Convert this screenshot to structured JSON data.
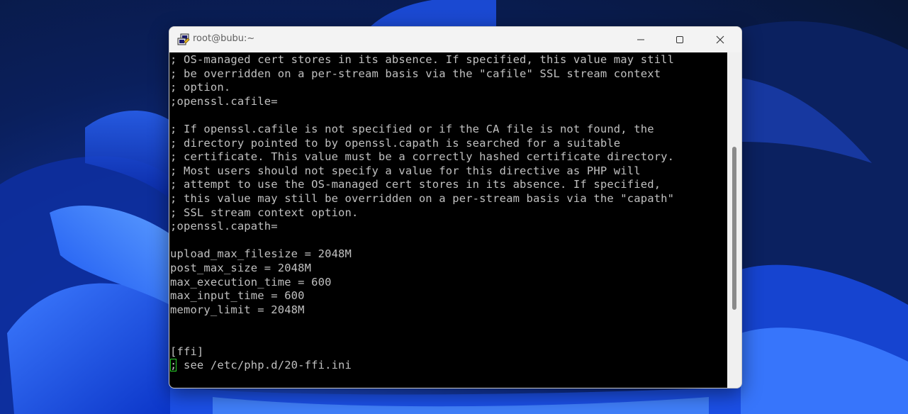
{
  "window": {
    "title": "root@bubu:~",
    "icon": "putty-icon",
    "controls": {
      "minimize": "minimize-icon",
      "maximize": "maximize-icon",
      "close": "close-icon"
    }
  },
  "terminal": {
    "lines": [
      "; OS-managed cert stores in its absence. If specified, this value may still",
      "; be overridden on a per-stream basis via the \"cafile\" SSL stream context",
      "; option.",
      ";openssl.cafile=",
      "",
      "; If openssl.cafile is not specified or if the CA file is not found, the",
      "; directory pointed to by openssl.capath is searched for a suitable",
      "; certificate. This value must be a correctly hashed certificate directory.",
      "; Most users should not specify a value for this directive as PHP will",
      "; attempt to use the OS-managed cert stores in its absence. If specified,",
      "; this value may still be overridden on a per-stream basis via the \"capath\"",
      "; SSL stream context option.",
      ";openssl.capath=",
      "",
      "upload_max_filesize = 2048M",
      "post_max_size = 2048M",
      "max_execution_time = 600",
      "max_input_time = 600",
      "memory_limit = 2048M",
      "",
      "",
      "[ffi]"
    ],
    "cursor_line": {
      "cursor_char": ";",
      "rest": " see /etc/php.d/20-ffi.ini"
    },
    "colors": {
      "background": "#000000",
      "foreground": "#c0c0c0",
      "cursor": "#2bd62b"
    }
  },
  "scrollbar": {
    "position_fraction": 0.55
  }
}
